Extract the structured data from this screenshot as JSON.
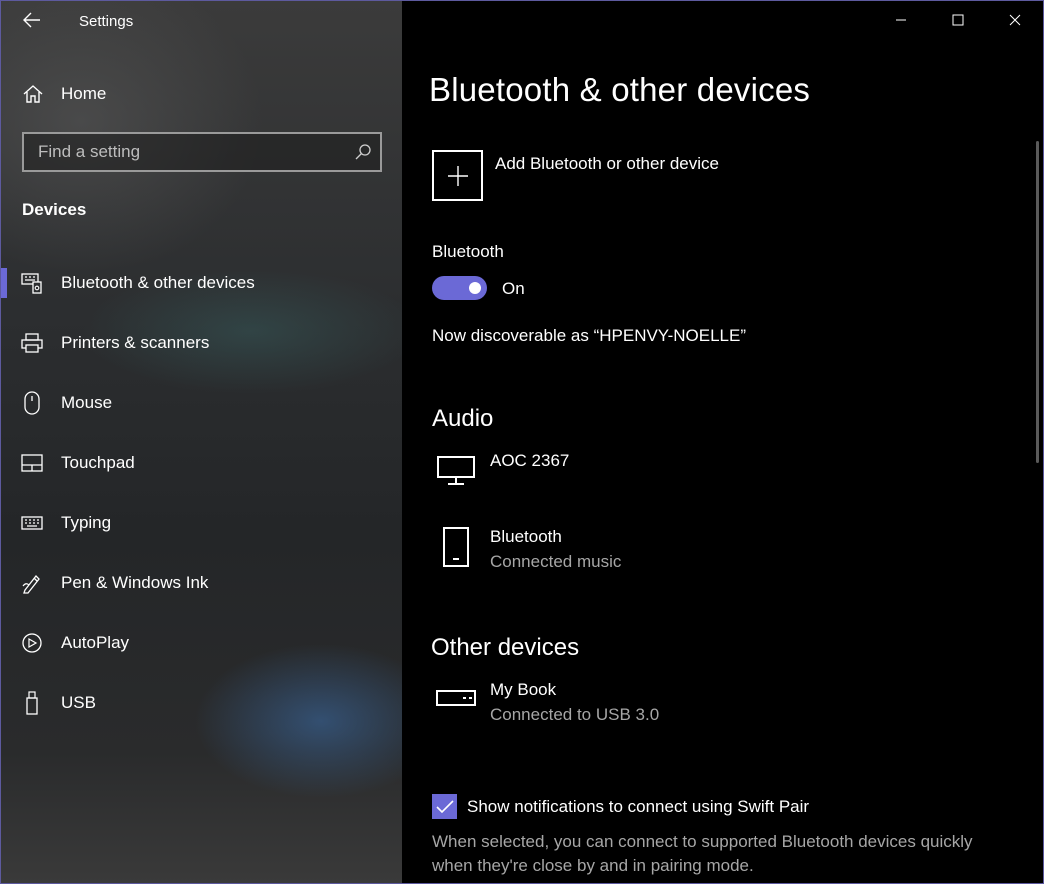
{
  "window": {
    "app_title": "Settings",
    "accent_color": "#6b69d6"
  },
  "titlebar": {
    "back_icon": "back-arrow-icon",
    "controls": [
      "minimize-icon",
      "maximize-icon",
      "close-icon"
    ]
  },
  "sidebar": {
    "home_label": "Home",
    "search_placeholder": "Find a setting",
    "section_label": "Devices",
    "items": [
      {
        "label": "Bluetooth & other devices",
        "icon": "bluetooth-devices-icon",
        "selected": true
      },
      {
        "label": "Printers & scanners",
        "icon": "printer-icon",
        "selected": false
      },
      {
        "label": "Mouse",
        "icon": "mouse-icon",
        "selected": false
      },
      {
        "label": "Touchpad",
        "icon": "touchpad-icon",
        "selected": false
      },
      {
        "label": "Typing",
        "icon": "keyboard-icon",
        "selected": false
      },
      {
        "label": "Pen & Windows Ink",
        "icon": "pen-icon",
        "selected": false
      },
      {
        "label": "AutoPlay",
        "icon": "autoplay-icon",
        "selected": false
      },
      {
        "label": "USB",
        "icon": "usb-icon",
        "selected": false
      }
    ]
  },
  "main": {
    "title": "Bluetooth & other devices",
    "add_device_label": "Add Bluetooth or other device",
    "bluetooth_label": "Bluetooth",
    "bluetooth_state": "On",
    "discoverable_text": "Now discoverable as “HPENVY-NOELLE”",
    "audio": {
      "title": "Audio",
      "devices": [
        {
          "name": "AOC 2367",
          "status": "",
          "icon": "monitor-icon"
        },
        {
          "name": "Bluetooth",
          "status": "Connected music",
          "icon": "phone-icon"
        }
      ]
    },
    "other": {
      "title": "Other devices",
      "devices": [
        {
          "name": "My Book",
          "status": "Connected to USB 3.0",
          "icon": "drive-icon"
        }
      ]
    },
    "swift_pair": {
      "label": "Show notifications to connect using Swift Pair",
      "checked": true,
      "description": "When selected, you can connect to supported Bluetooth devices quickly when they're close by and in pairing mode."
    }
  }
}
